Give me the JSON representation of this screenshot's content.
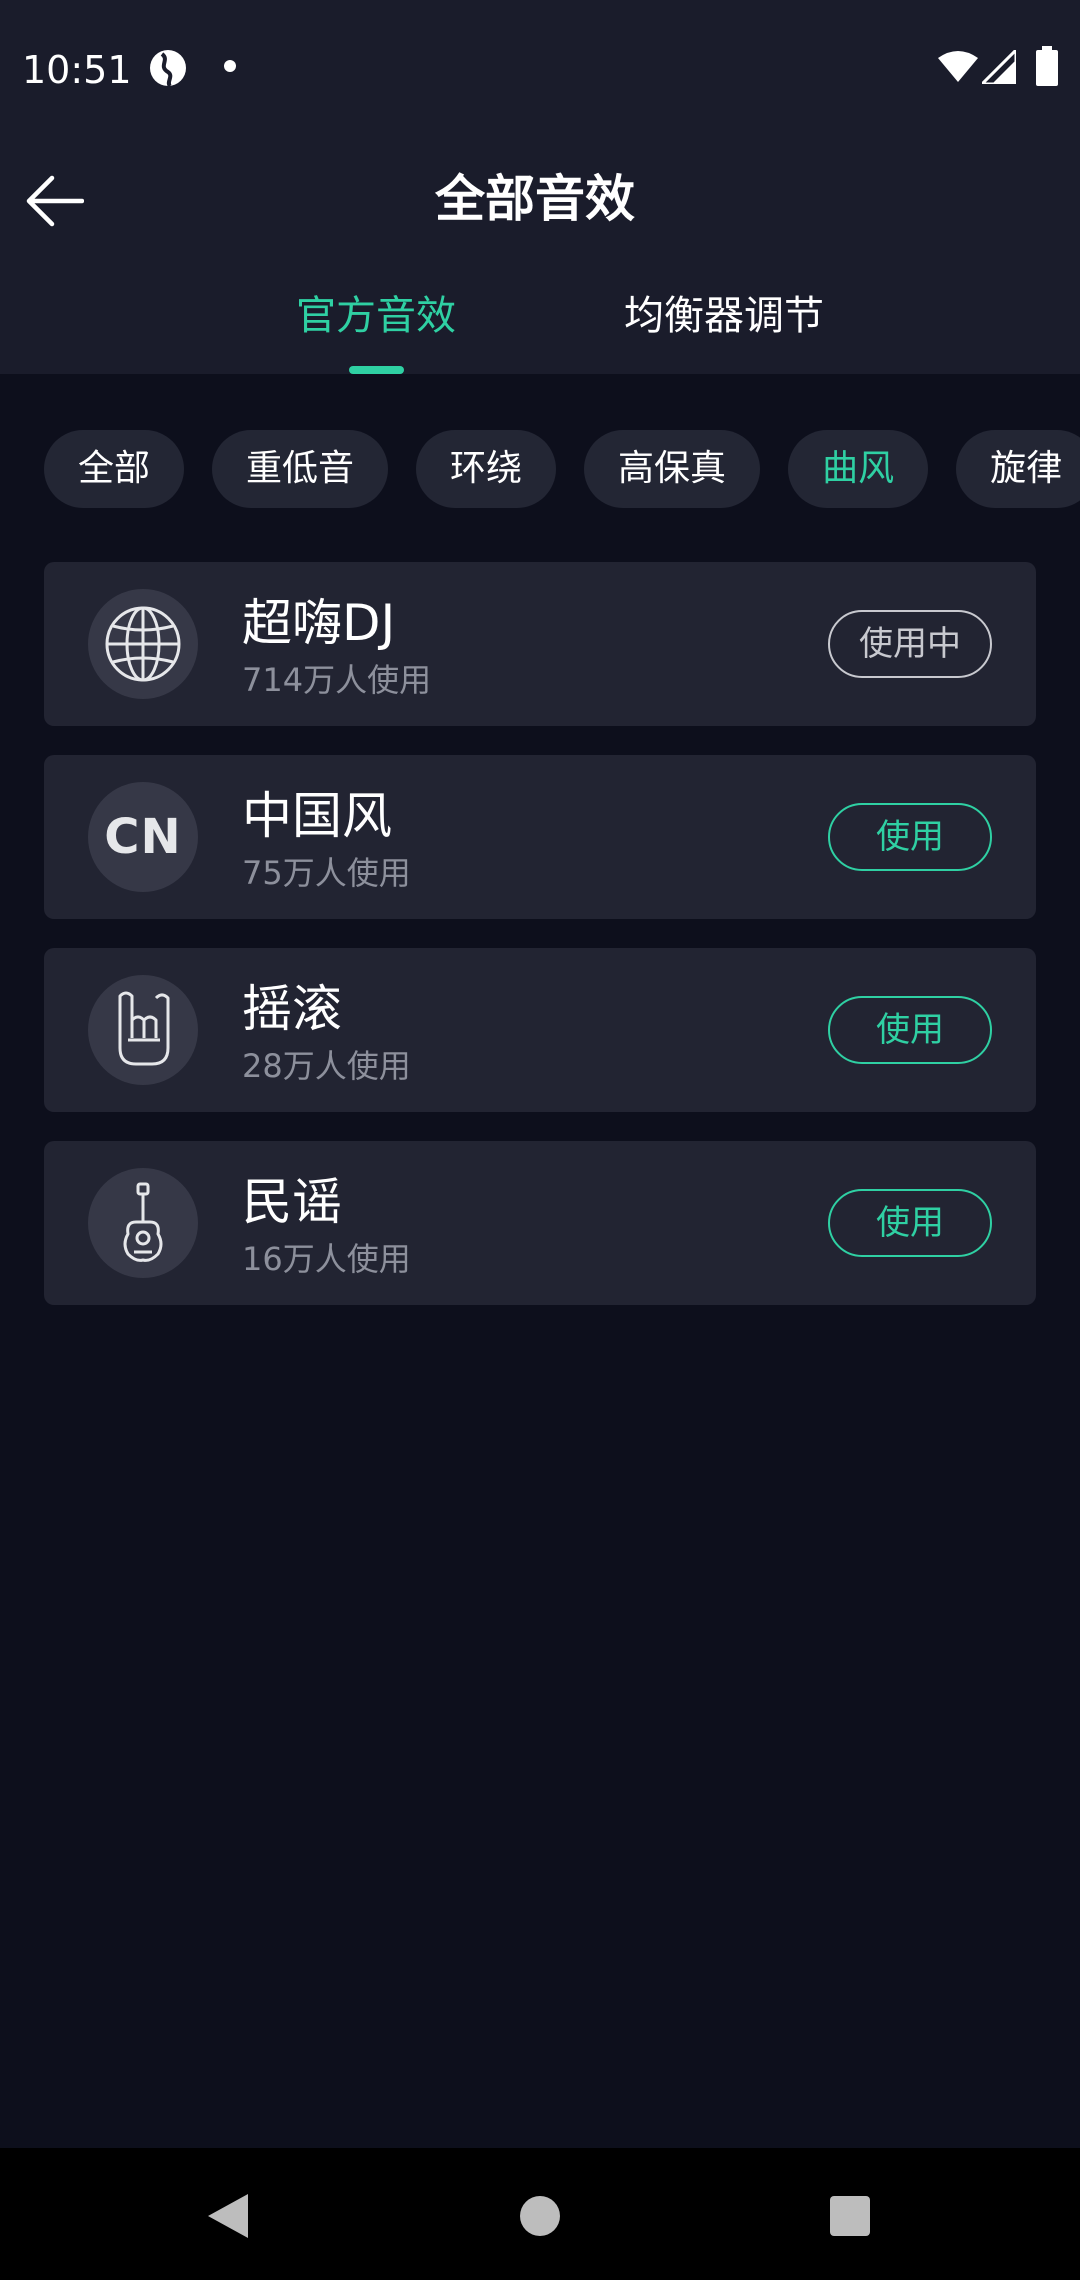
{
  "status_bar": {
    "time": "10:51",
    "icons": [
      "globe-icon",
      "notification-dot",
      "wifi-icon",
      "signal-icon",
      "battery-icon"
    ]
  },
  "header": {
    "back_icon": "arrow-left-icon",
    "title": "全部音效"
  },
  "tabs": [
    {
      "label": "官方音效",
      "active": true
    },
    {
      "label": "均衡器调节",
      "active": false
    }
  ],
  "chips": [
    {
      "label": "全部",
      "active": false
    },
    {
      "label": "重低音",
      "active": false
    },
    {
      "label": "环绕",
      "active": false
    },
    {
      "label": "高保真",
      "active": false
    },
    {
      "label": "曲风",
      "active": true
    },
    {
      "label": "旋律",
      "active": false
    }
  ],
  "effects": [
    {
      "name": "超嗨DJ",
      "users": "714万人使用",
      "icon": "globe-icon",
      "button": "使用中",
      "in_use": true
    },
    {
      "name": "中国风",
      "users": "75万人使用",
      "icon_text": "CN",
      "icon": "cn-badge-icon",
      "button": "使用",
      "in_use": false
    },
    {
      "name": "摇滚",
      "users": "28万人使用",
      "icon": "rock-hand-icon",
      "button": "使用",
      "in_use": false
    },
    {
      "name": "民谣",
      "users": "16万人使用",
      "icon": "guitar-icon",
      "button": "使用",
      "in_use": false
    }
  ],
  "colors": {
    "accent": "#2fd0a3",
    "background": "#0d0f1c",
    "header_background": "#1a1c2b",
    "card_background": "#222432"
  },
  "nav_bar": {
    "icons": [
      "nav-back-icon",
      "nav-home-icon",
      "nav-recents-icon"
    ]
  }
}
